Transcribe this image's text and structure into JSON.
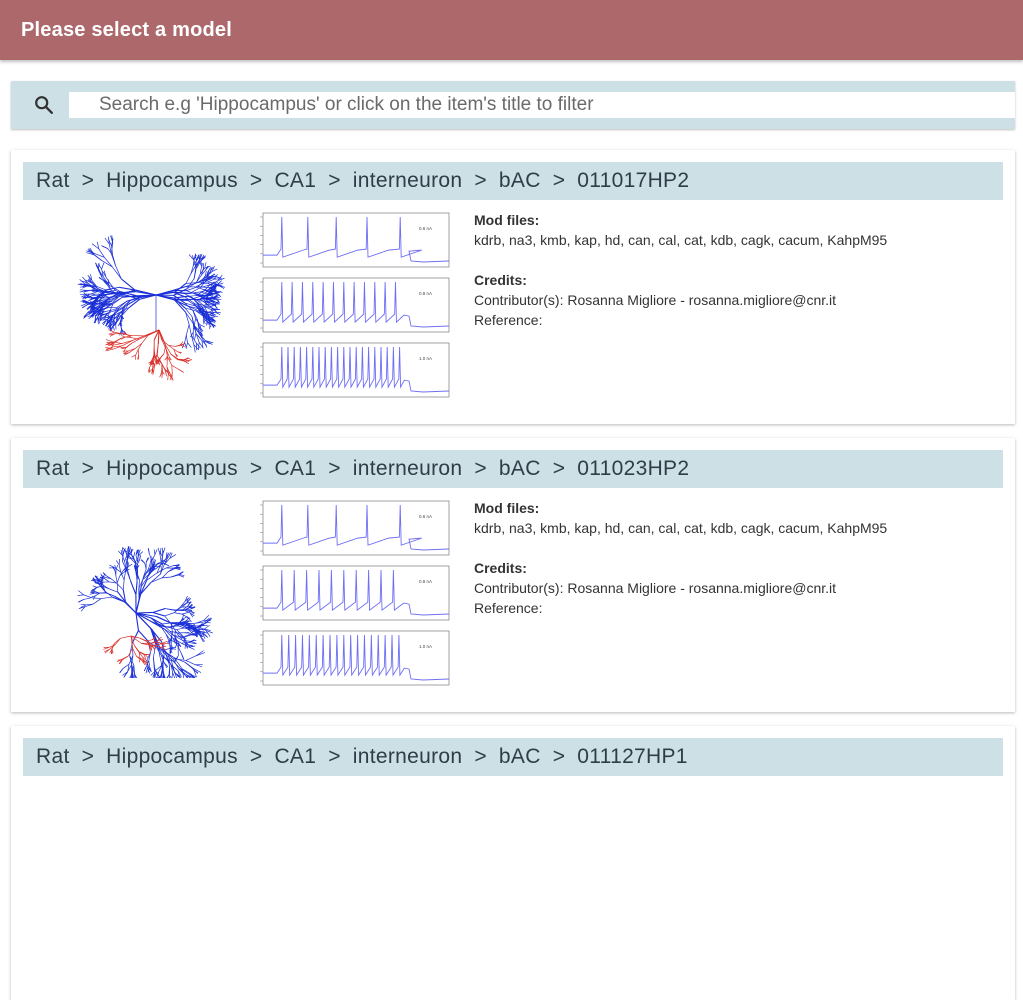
{
  "header": {
    "title": "Please select a model"
  },
  "search": {
    "icon": "search-icon",
    "placeholder": "Search e.g 'Hippocampus' or click on the item's title to filter"
  },
  "labels": {
    "mod_files": "Mod files:",
    "credits": "Credits:",
    "contributor_prefix": "Contributor(s): ",
    "reference": "Reference:",
    "separator": ">"
  },
  "models": [
    {
      "breadcrumb": [
        "Rat",
        "Hippocampus",
        "CA1",
        "interneuron",
        "bAC",
        "011017HP2"
      ],
      "mod_files": "kdrb, na3, kmb, kap, hd, can, cal, cat, kdb, cagk, cacum, KahpM95",
      "contributor": "Rosanna Migliore - rosanna.migliore@cnr.it",
      "trace_labels": [
        "0.6 nA",
        "0.8 nA",
        "1.0 nA"
      ]
    },
    {
      "breadcrumb": [
        "Rat",
        "Hippocampus",
        "CA1",
        "interneuron",
        "bAC",
        "011023HP2"
      ],
      "mod_files": "kdrb, na3, kmb, kap, hd, can, cal, cat, kdb, cagk, cacum, KahpM95",
      "contributor": "Rosanna Migliore - rosanna.migliore@cnr.it",
      "trace_labels": [
        "0.6 nA",
        "0.8 nA",
        "1.0 nA"
      ]
    },
    {
      "breadcrumb": [
        "Rat",
        "Hippocampus",
        "CA1",
        "interneuron",
        "bAC",
        "011127HP1"
      ]
    }
  ],
  "colors": {
    "header_bg": "#ad686c",
    "title_bg": "#cde0e6",
    "axon": "#1a2fd6",
    "dendrite": "#d9302a",
    "trace": "#6f6ff5"
  }
}
